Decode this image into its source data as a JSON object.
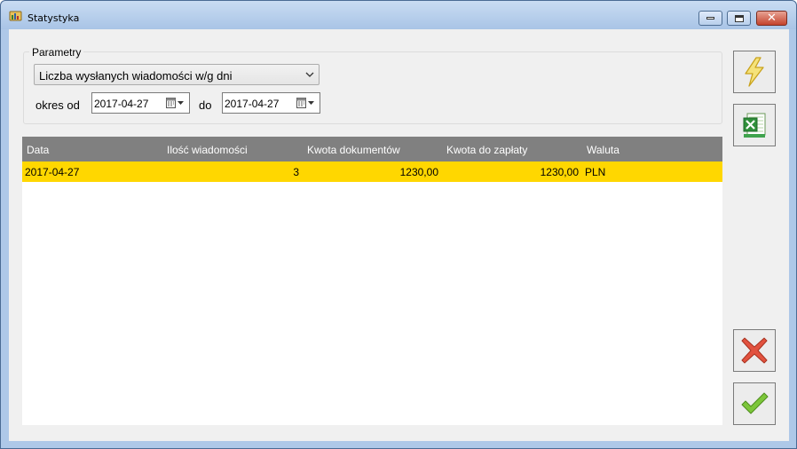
{
  "window": {
    "title": "Statystyka",
    "controls": {
      "minimize": "minimize",
      "maximize": "maximize",
      "close": "✕"
    }
  },
  "params": {
    "legend": "Parametry",
    "report_type": "Liczba wysłanych wiadomości w/g dni",
    "okres_od_label": "okres od",
    "date_from": "2017-04-27",
    "do_label": "do",
    "date_to": "2017-04-27"
  },
  "table": {
    "headers": [
      "Data",
      "Ilość wiadomości",
      "Kwota dokumentów",
      "Kwota do zapłaty",
      "Waluta"
    ],
    "rows": [
      [
        "2017-04-27",
        "3",
        "1230,00",
        "1230,00",
        "PLN"
      ]
    ]
  },
  "buttons": {
    "run": "lightning-icon",
    "excel": "excel-export-icon",
    "cancel": "cross-icon",
    "ok": "checkmark-icon"
  },
  "colors": {
    "selected_row": "#ffd700",
    "header_bg": "#808080",
    "title_bar": "#aec8e8"
  }
}
